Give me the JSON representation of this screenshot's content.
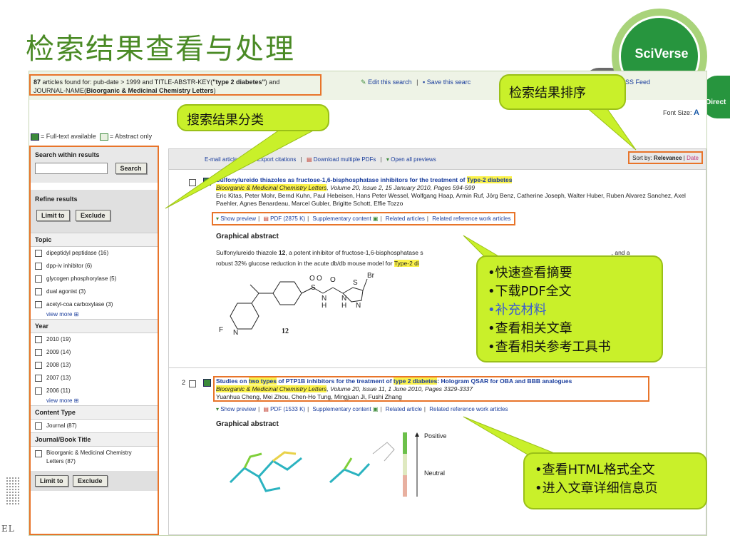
{
  "slide": {
    "title": "检索结果查看与处理",
    "logo_text": "SciVerse",
    "direct_text": "Direct"
  },
  "topbar": {
    "query_count": "87",
    "query_rest1": " articles found for: pub-date > 1999 and TITLE-ABSTR-KEY(",
    "query_bold1": "\"type 2 diabetes\"",
    "query_rest2": ") and",
    "query_line2a": "JOURNAL-NAME(",
    "query_bold2": "Bioorganic & Medicinal Chemistry Letters",
    "query_line2b": ")",
    "edit_search": "Edit this search",
    "save_search": "Save this searc",
    "rss": "SS Feed",
    "font_size_label": "Font Size:",
    "font_size_glyph": "A"
  },
  "legend": {
    "fulltext": "= Full-text available",
    "abstract": "= Abstract only"
  },
  "sidebar": {
    "search_heading": "Search within results",
    "search_button": "Search",
    "search_value": "",
    "refine_heading": "Refine results",
    "limit_to": "Limit to",
    "exclude": "Exclude",
    "facets": [
      {
        "heading": "Topic",
        "items": [
          "dipeptidyl peptidase (16)",
          "dpp-iv inhibitor (6)",
          "glycogen phosphorylase (5)",
          "dual agonist (3)",
          "acetyl-coa carboxylase (3)"
        ],
        "view_more": "view more"
      },
      {
        "heading": "Year",
        "items": [
          "2010 (19)",
          "2009 (14)",
          "2008 (13)",
          "2007 (13)",
          "2006 (11)"
        ],
        "view_more": "view more"
      },
      {
        "heading": "Content Type",
        "items": [
          "Journal (87)"
        ],
        "view_more": ""
      },
      {
        "heading": "Journal/Book Title",
        "items": [
          "Bioorganic & Medicinal Chemistry Letters (87)"
        ],
        "view_more": ""
      }
    ]
  },
  "results_bar": {
    "email": "E-mail articles",
    "export": "Export citations",
    "download_pdfs": "Download multiple PDFs",
    "open_previews": "Open all previews",
    "sort_label": "Sort by:",
    "sort_relevance": "Relevance",
    "sort_date": "Date"
  },
  "results": [
    {
      "num": "",
      "title_a": "Sulfonylureido thiazoles as fructose-1,6-bisphosphatase inhibitors for the treatment of ",
      "title_hl": "Type-2 diabetes",
      "title_b": "",
      "journal": "Bioorganic & Medicinal Chemistry Letters",
      "citation": ", Volume 20, Issue 2, 15 January 2010, Pages 594-599",
      "authors": "Eric Kitas, Peter Mohr, Bernd Kuhn, Paul Hebeisen, Hans Peter Wessel, Wolfgang Haap, Armin Ruf, Jörg Benz, Catherine Joseph, Walter Huber, Ruben Alvarez Sanchez, Axel Paehler, Agnes Benardeau, Marcel Gubler, Brigitte Schott, Effie Tozzo",
      "links": [
        "Show preview",
        "PDF (2875 K)",
        "Supplementary content",
        "Related articles",
        "Related reference work articles"
      ],
      "ga_heading": "Graphical abstract",
      "ga_text_a": "Sulfonylureido thiazole ",
      "ga_bold": "12",
      "ga_text_b": ", a potent inhibitor of fructose-1,6-bisphosphatase s",
      "ga_text_c": ", and a",
      "ga_line2a": "robust 32% glucose reduction in the acute db/db mouse model for ",
      "ga_line2hl": "Type-2 di",
      "compound_label": "12"
    },
    {
      "num": "2",
      "title_a": "Studies on ",
      "title_hl": "two types",
      "title_mid": " of PTP1B inhibitors for the treatment of ",
      "title_hl2": "type 2 diabetes",
      "title_b": ": Hologram QSAR for OBA and BBB analogues",
      "journal": "Bioorganic & Medicinal Chemistry Letters",
      "citation": ", Volume 20, Issue 11, 1 June 2010, Pages 3329-3337",
      "authors": "Yuanhua Cheng, Mei Zhou, Chen-Ho Tung, Mingjuan Ji, Fushi Zhang",
      "links": [
        "Show preview",
        "PDF (1533 K)",
        "Supplementary content",
        "Related article",
        "Related reference work articles"
      ],
      "ga_heading": "Graphical abstract",
      "scale_top": "Positive",
      "scale_mid": "Neutral"
    }
  ],
  "callouts": {
    "sort": "检索结果排序",
    "facets": "搜索结果分类",
    "actions": [
      "•快速查看摘要",
      "•下载PDF全文",
      "•补充材料",
      "•查看相关文章",
      "•查看相关参考工具书"
    ],
    "html": [
      "•查看HTML格式全文",
      "•进入文章详细信息页"
    ]
  },
  "colors": {
    "accent_orange": "#e8742a",
    "callout_green": "#c9f02a",
    "title_green": "#4a8a25",
    "link_blue": "#1a3d9c",
    "highlight": "#fbf24a"
  }
}
